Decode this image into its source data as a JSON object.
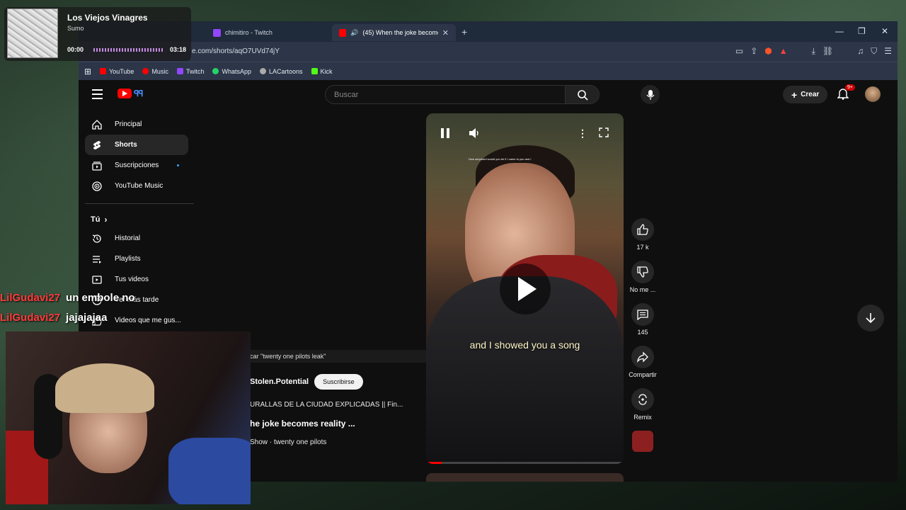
{
  "browser": {
    "tabs": [
      {
        "label": "chimitiro - Twitch",
        "color": "#9146ff"
      },
      {
        "label": "(45) When the joke becomes",
        "color": "#ff0000"
      }
    ],
    "url": "e.com/shorts/aqO7UVd74jY",
    "bookmarks": [
      {
        "label": "YouTube",
        "color": "#ff0000"
      },
      {
        "label": "Music",
        "color": "#ff0000"
      },
      {
        "label": "Twitch",
        "color": "#9146ff"
      },
      {
        "label": "WhatsApp",
        "color": "#25d366"
      },
      {
        "label": "LACartoons",
        "color": "#aaaaaa"
      },
      {
        "label": "Kick",
        "color": "#53fc18"
      }
    ]
  },
  "yt": {
    "search_placeholder": "Buscar",
    "create_label": "Crear",
    "notif_badge": "9+",
    "sidebar": {
      "items": [
        {
          "label": "Principal",
          "icon": "home-icon"
        },
        {
          "label": "Shorts",
          "icon": "shorts-icon"
        },
        {
          "label": "Suscripciones",
          "icon": "subscriptions-icon"
        },
        {
          "label": "YouTube Music",
          "icon": "music-icon"
        }
      ],
      "you_label": "Tú",
      "you_items": [
        {
          "label": "Historial",
          "icon": "history-icon"
        },
        {
          "label": "Playlists",
          "icon": "playlist-icon"
        },
        {
          "label": "Tus videos",
          "icon": "video-icon"
        },
        {
          "label": "Ver más tarde",
          "icon": "clock-icon"
        },
        {
          "label": "Videos que me gus...",
          "icon": "like-icon"
        }
      ]
    },
    "short": {
      "overlay_text": "How surprised would you be if I came to you and I",
      "caption": "and I showed you a song",
      "progress": 0.08
    },
    "actions": {
      "likes": "17 k",
      "dislike": "No me ...",
      "comments": "145",
      "share": "Compartir",
      "remix": "Remix"
    },
    "meta": {
      "search_chip": "car \"twenty one pilots leak\"",
      "channel": "Stolen.Potential",
      "subscribe": "Suscribirse",
      "line1": "URALLAS DE LA CIUDAD EXPLICADAS || Fin...",
      "title": "he joke becomes reality ...",
      "song": "Show · twenty one pilots"
    }
  },
  "music": {
    "title": "Los Viejos Vinagres",
    "artist": "Sumo",
    "current": "00:00",
    "total": "03:18"
  },
  "chat": [
    {
      "user": "LilGudavi27",
      "msg": "un embole no"
    },
    {
      "user": "LilGudavi27",
      "msg": "jajajajaa"
    }
  ]
}
